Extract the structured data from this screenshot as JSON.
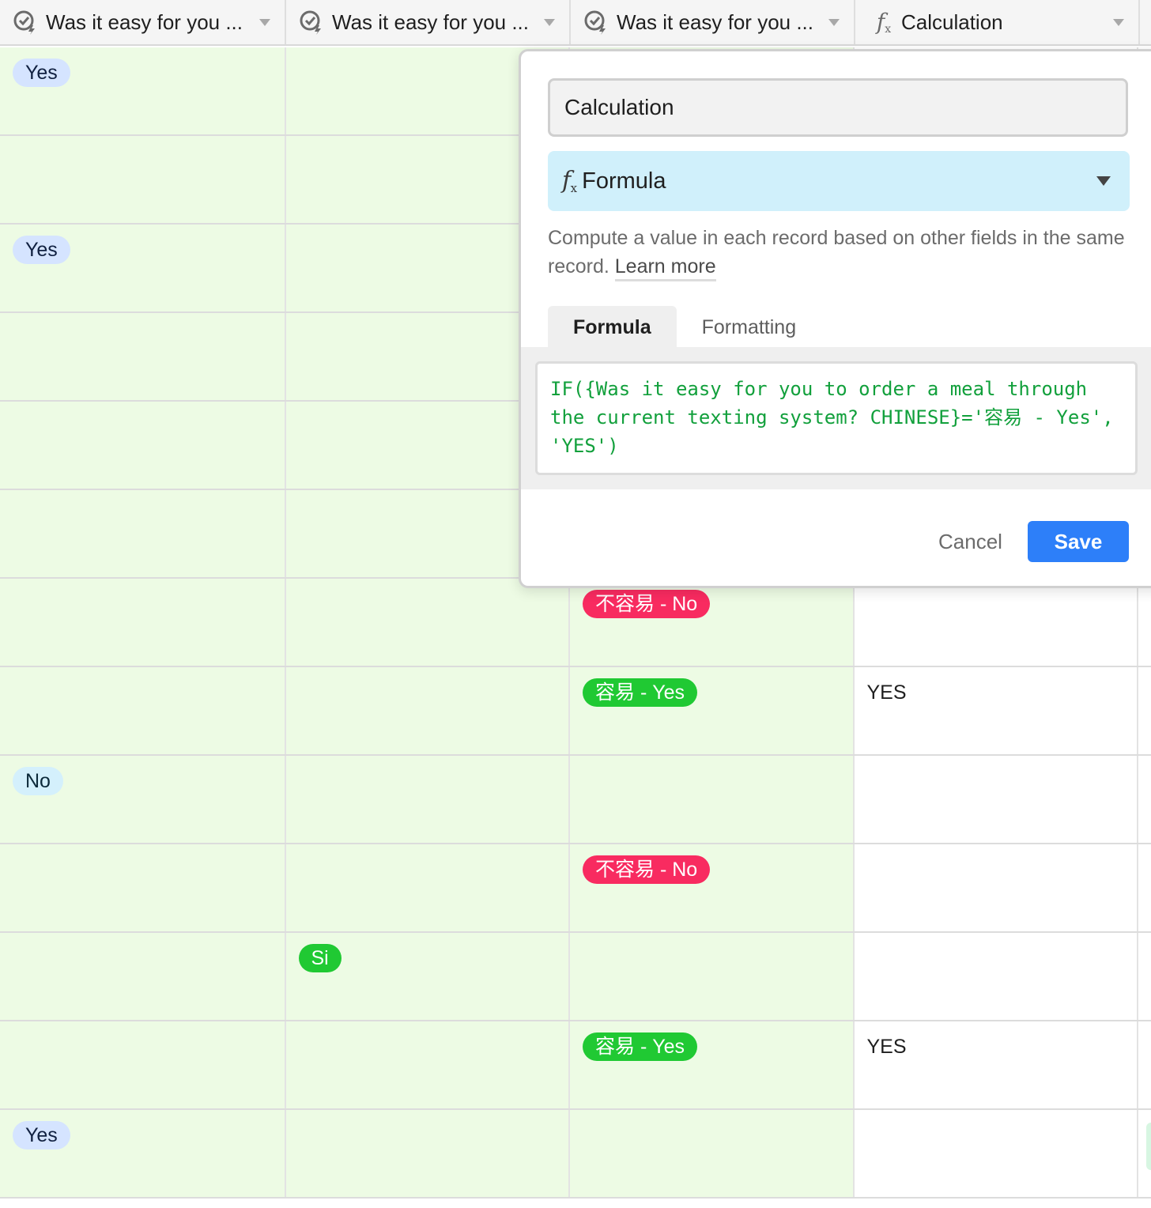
{
  "columns": [
    {
      "name": "Was it easy for you ...",
      "icon": "lookup-icon"
    },
    {
      "name": "Was it easy for you ...",
      "icon": "lookup-icon"
    },
    {
      "name": "Was it easy for you ...",
      "icon": "lookup-icon"
    },
    {
      "name": "Calculation",
      "icon": "formula-icon"
    }
  ],
  "rows": [
    {
      "c1": "Yes",
      "c2": "",
      "c3": "",
      "calc": ""
    },
    {
      "c1": "",
      "c2": "",
      "c3": "",
      "calc": ""
    },
    {
      "c1": "Yes",
      "c2": "",
      "c3": "",
      "calc": ""
    },
    {
      "c1": "",
      "c2": "",
      "c3": "",
      "calc": ""
    },
    {
      "c1": "",
      "c2": "",
      "c3": "",
      "calc": ""
    },
    {
      "c1": "",
      "c2": "",
      "c3": "",
      "calc": ""
    },
    {
      "c1": "",
      "c2": "",
      "c3": "不容易 - No",
      "calc": ""
    },
    {
      "c1": "",
      "c2": "",
      "c3": "容易 - Yes",
      "calc": "YES"
    },
    {
      "c1": "No",
      "c2": "",
      "c3": "",
      "calc": ""
    },
    {
      "c1": "",
      "c2": "",
      "c3": "不容易 - No",
      "calc": ""
    },
    {
      "c1": "",
      "c2": "Si",
      "c3": "",
      "calc": ""
    },
    {
      "c1": "",
      "c2": "",
      "c3": "容易 - Yes",
      "calc": "YES"
    },
    {
      "c1": "Yes",
      "c2": "",
      "c3": "",
      "calc": ""
    }
  ],
  "option_colors": {
    "Yes": "blue",
    "No": "lightblue",
    "Si": "green",
    "容易 - Yes": "green",
    "不容易 - No": "red"
  },
  "colors": {
    "cell_green_bg": "#edfbe4",
    "type_select_bg": "#d0f0fb",
    "save_button": "#2d7ff9",
    "formula_text": "#12a03c",
    "pill_red": "#f82b60",
    "pill_green": "#20c933",
    "pill_blue": "#d5e4ff",
    "pill_lightblue": "#d4f0fc"
  },
  "popover": {
    "field_name": "Calculation",
    "field_type": "Formula",
    "field_type_icon": "formula-icon",
    "description": "Compute a value in each record based on other fields in the same record.",
    "learn_more": "Learn more",
    "tabs": [
      {
        "label": "Formula",
        "active": true
      },
      {
        "label": "Formatting",
        "active": false
      }
    ],
    "formula": "IF({Was it easy for you to order a meal through the current texting system? CHINESE}='容易 - Yes', 'YES')",
    "cancel_label": "Cancel",
    "save_label": "Save"
  }
}
